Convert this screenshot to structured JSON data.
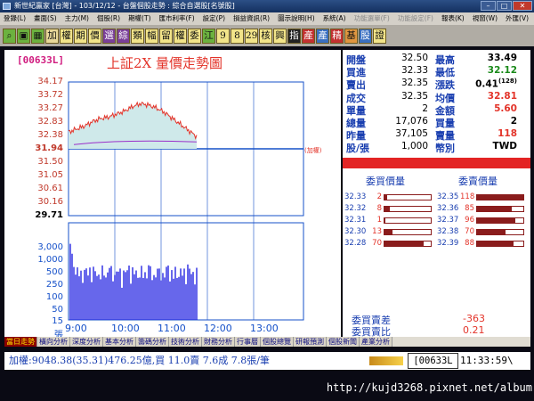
{
  "window": {
    "title": "新世紀贏家 [台灣] - 103/12/12 - 台盤個股走勢 : 綜合自選股[名號股]"
  },
  "menu": [
    "登錄(L)",
    "畫面(S)",
    "主力(M)",
    "個股(R)",
    "期權(T)",
    "匯市利率(F)",
    "設定(P)",
    "損益資訊(R)",
    "圖示說明(H)",
    "系統(A)",
    "功能選單(F)",
    "功能設定(F)",
    "報表(K)",
    "視窗(W)",
    "外匯(V)"
  ],
  "toolbar": [
    "加",
    "權",
    "期",
    "價",
    "選",
    "綜",
    "類",
    "幅",
    "留",
    "權",
    "委",
    "江",
    "9",
    "8",
    "29",
    "核",
    "興",
    "指",
    "產",
    "產",
    "精",
    "基",
    "股",
    "證"
  ],
  "chart": {
    "stock_code": "[00633L]",
    "title": "上証2X  量價走勢圖",
    "price_ticks": [
      "34.17",
      "33.72",
      "33.27",
      "32.83",
      "32.38",
      "31.94",
      "31.50",
      "31.05",
      "30.61",
      "30.16",
      "29.71"
    ],
    "reference_price": "31.94",
    "volume_ticks": [
      "3,000",
      "1,000",
      "500",
      "250",
      "100",
      "50",
      "15"
    ],
    "volume_unit": "張",
    "time_ticks": [
      "9:00",
      "10:00",
      "11:00",
      "12:00",
      "13:00"
    ],
    "index_label": "(加權)"
  },
  "chart_data": {
    "type": "line",
    "x": [
      "9:00",
      "9:10",
      "9:20",
      "9:30",
      "9:40",
      "9:50",
      "10:00",
      "10:10",
      "10:20",
      "10:30",
      "10:40",
      "10:50",
      "11:00",
      "11:10",
      "11:20",
      "11:30",
      "11:33"
    ],
    "series": [
      {
        "name": "",
        "values": [
          32.5,
          32.6,
          32.7,
          32.85,
          32.95,
          33.0,
          33.1,
          33.2,
          33.35,
          33.45,
          33.4,
          33.3,
          33.15,
          32.95,
          32.75,
          32.55,
          32.35
        ]
      }
    ],
    "ylim": [
      29.71,
      34.17
    ],
    "volume_ylim": [
      0,
      3000
    ]
  },
  "quote": {
    "left_labels": [
      "開盤",
      "買進",
      "賣出",
      "成交",
      "單量",
      "總量",
      "昨量",
      "股/張"
    ],
    "left_values": [
      "32.50",
      "32.33",
      "32.35",
      "32.35",
      "2",
      "17,076",
      "37,105",
      "1,000"
    ],
    "right_labels": [
      "最高",
      "最低",
      "漲跌",
      "均價",
      "金額",
      "買量",
      "賣量",
      "幣別"
    ],
    "right_values": [
      "33.49",
      "32.12",
      "0.41",
      "32.81",
      "5.60",
      "2",
      "118",
      "TWD"
    ],
    "change_superscript": "(128)"
  },
  "book": {
    "bid_header": "委買價量",
    "ask_header": "委賣價量",
    "bids": [
      {
        "price": "32.33",
        "qty": "2",
        "fill": 0.05
      },
      {
        "price": "32.32",
        "qty": "8",
        "fill": 0.12
      },
      {
        "price": "32.31",
        "qty": "1",
        "fill": 0.02
      },
      {
        "price": "32.30",
        "qty": "13",
        "fill": 0.18
      },
      {
        "price": "32.28",
        "qty": "70",
        "fill": 0.85
      }
    ],
    "asks": [
      {
        "price": "32.35",
        "qty": "118",
        "fill": 1.0
      },
      {
        "price": "32.36",
        "qty": "85",
        "fill": 0.75
      },
      {
        "price": "32.37",
        "qty": "96",
        "fill": 0.82
      },
      {
        "price": "32.38",
        "qty": "70",
        "fill": 0.62
      },
      {
        "price": "32.39",
        "qty": "88",
        "fill": 0.78
      }
    ],
    "diff_label": "委買賣差",
    "diff_value": "-363",
    "ratio_label": "委買賣比",
    "ratio_value": "0.21"
  },
  "tabs": [
    "當日走勢",
    "橫向分析",
    "深度分析",
    "基本分析",
    "籌碼分析",
    "技術分析",
    "財務分析",
    "行事曆",
    "個股總覽",
    "研報預測",
    "個股新聞",
    "產業分析"
  ],
  "status": {
    "ticker_text": "加權:9048.38(35.31)476.25億,買 11.0賣 7.6成 7.8張/筆",
    "code": "[00633L",
    "time": "11:33:59\\"
  },
  "watermark": "http://kujd3268.pixnet.net/album"
}
